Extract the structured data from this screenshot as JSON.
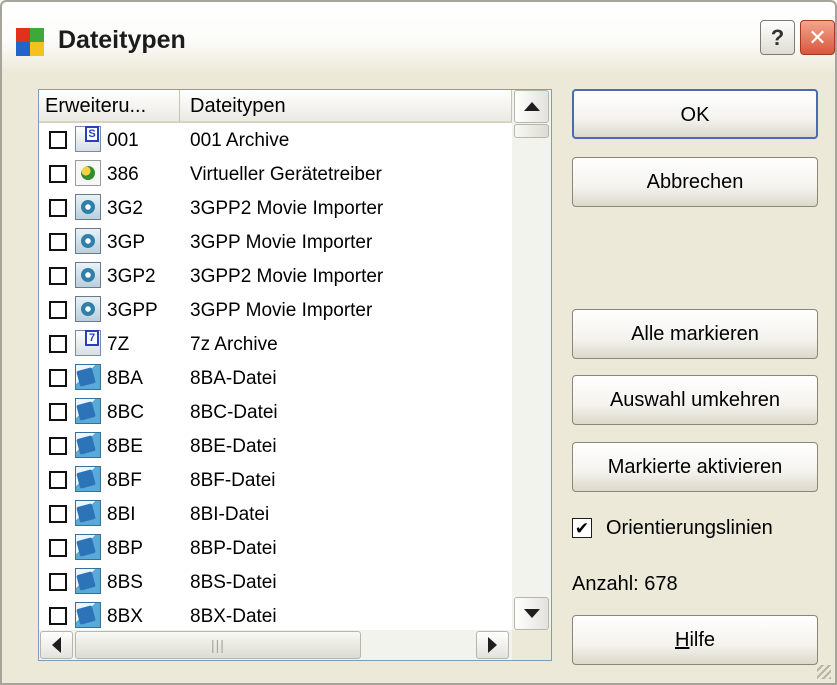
{
  "window": {
    "title": "Dateitypen",
    "help_label": "?",
    "close_label": "✕"
  },
  "colors": {
    "dialog_bg": "#ece9d8",
    "list_border": "#7f9db9",
    "close_button": "#d9573c"
  },
  "list": {
    "headers": [
      "Erweiteru...",
      "Dateitypen"
    ],
    "rows": [
      {
        "ext": "001",
        "desc": "001 Archive",
        "icon": "archive-s-icon",
        "checked": false
      },
      {
        "ext": "386",
        "desc": "Virtueller Gerätetreiber",
        "icon": "driver-gear-icon",
        "checked": false
      },
      {
        "ext": "3G2",
        "desc": "3GPP2 Movie Importer",
        "icon": "movie-file-icon",
        "checked": false
      },
      {
        "ext": "3GP",
        "desc": "3GPP Movie Importer",
        "icon": "movie-file-icon",
        "checked": false
      },
      {
        "ext": "3GP2",
        "desc": "3GPP2 Movie Importer",
        "icon": "movie-file-icon",
        "checked": false
      },
      {
        "ext": "3GPP",
        "desc": "3GPP Movie Importer",
        "icon": "movie-file-icon",
        "checked": false
      },
      {
        "ext": "7Z",
        "desc": "7z Archive",
        "icon": "archive-7z-icon",
        "checked": false
      },
      {
        "ext": "8BA",
        "desc": "8BA-Datei",
        "icon": "ps-plugin-icon",
        "checked": false
      },
      {
        "ext": "8BC",
        "desc": "8BC-Datei",
        "icon": "ps-plugin-icon",
        "checked": false
      },
      {
        "ext": "8BE",
        "desc": "8BE-Datei",
        "icon": "ps-plugin-icon",
        "checked": false
      },
      {
        "ext": "8BF",
        "desc": "8BF-Datei",
        "icon": "ps-plugin-icon",
        "checked": false
      },
      {
        "ext": "8BI",
        "desc": "8BI-Datei",
        "icon": "ps-plugin-icon",
        "checked": false
      },
      {
        "ext": "8BP",
        "desc": "8BP-Datei",
        "icon": "ps-plugin-icon",
        "checked": false
      },
      {
        "ext": "8BS",
        "desc": "8BS-Datei",
        "icon": "ps-plugin-icon",
        "checked": false
      },
      {
        "ext": "8BX",
        "desc": "8BX-Datei",
        "icon": "ps-plugin-icon",
        "checked": false
      }
    ]
  },
  "buttons": {
    "ok": "OK",
    "cancel": "Abbrechen",
    "select_all": "Alle markieren",
    "invert_selection": "Auswahl umkehren",
    "activate_marked": "Markierte aktivieren",
    "help_prefix": "",
    "help_accel": "H",
    "help_rest": "ilfe"
  },
  "options": {
    "guide_lines_label": "Orientierungslinien",
    "guide_lines_checked": true,
    "check_mark": "✔"
  },
  "status": {
    "count_text": "Anzahl: 678"
  },
  "scrollbar": {
    "h_thumb_grip": "|||"
  }
}
